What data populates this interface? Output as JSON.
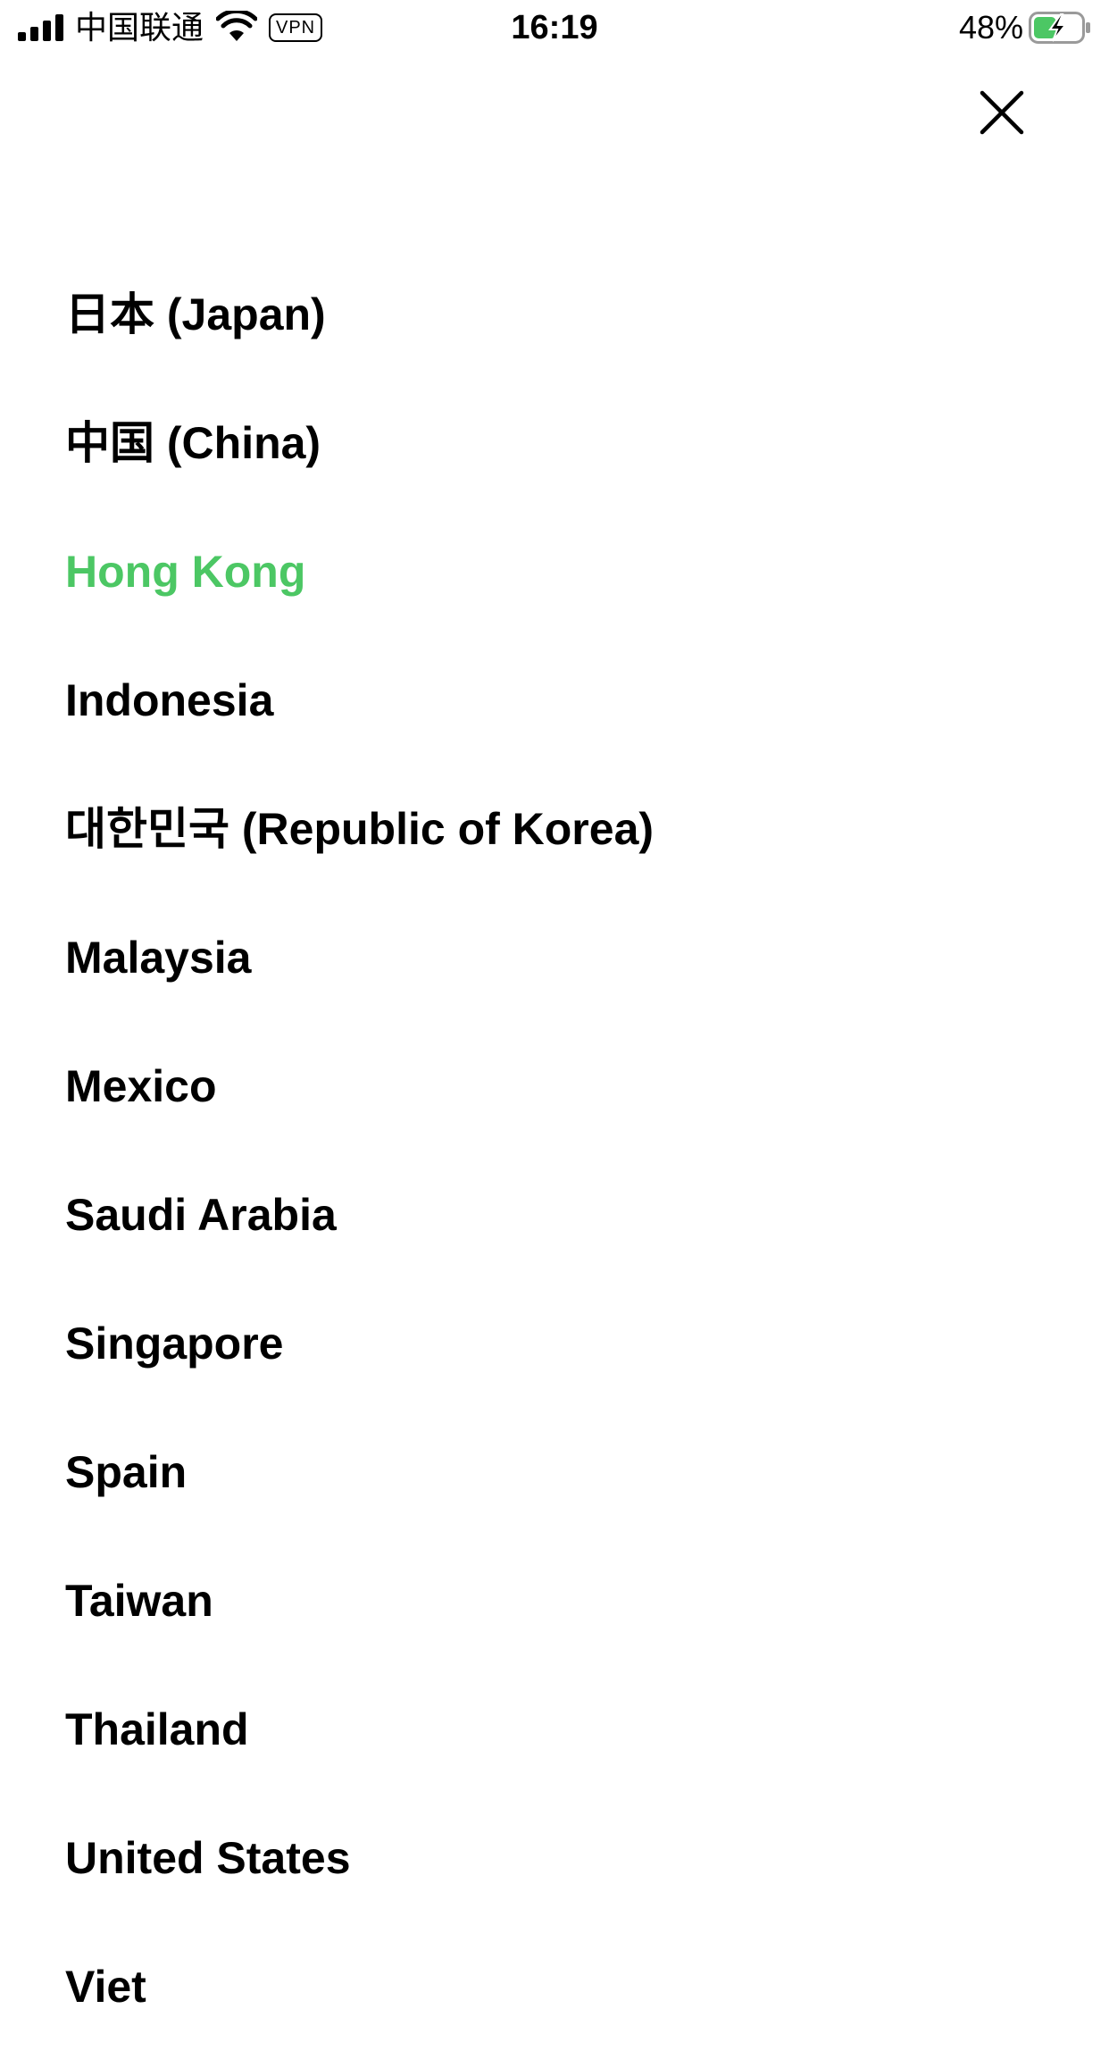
{
  "status_bar": {
    "carrier": "中国联通",
    "vpn": "VPN",
    "time": "16:19",
    "battery_percent": "48%",
    "battery_level": 0.48,
    "battery_charging": true,
    "icons": [
      "signal-icon",
      "wifi-icon",
      "battery-icon",
      "charging-bolt-icon"
    ]
  },
  "header": {
    "close_icon": "close-icon"
  },
  "colors": {
    "selected": "#4cc764",
    "text": "#000000",
    "background": "#ffffff",
    "battery_fill": "#4cc764"
  },
  "regions": [
    {
      "label": "日本 (Japan)",
      "selected": false
    },
    {
      "label": "中国 (China)",
      "selected": false
    },
    {
      "label": "Hong Kong",
      "selected": true
    },
    {
      "label": "Indonesia",
      "selected": false
    },
    {
      "label": "대한민국 (Republic of Korea)",
      "selected": false
    },
    {
      "label": "Malaysia",
      "selected": false
    },
    {
      "label": "Mexico",
      "selected": false
    },
    {
      "label": "Saudi Arabia",
      "selected": false
    },
    {
      "label": "Singapore",
      "selected": false
    },
    {
      "label": "Spain",
      "selected": false
    },
    {
      "label": "Taiwan",
      "selected": false
    },
    {
      "label": "Thailand",
      "selected": false
    },
    {
      "label": "United States",
      "selected": false
    },
    {
      "label": "Viet",
      "selected": false
    }
  ]
}
